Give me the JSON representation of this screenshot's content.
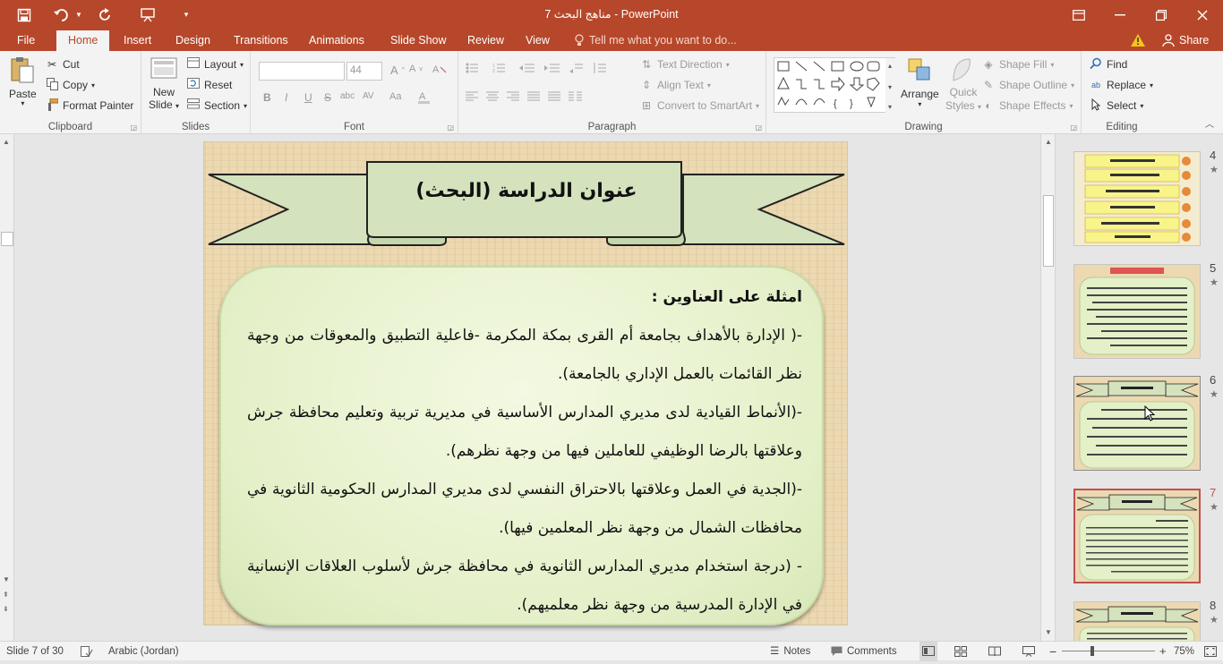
{
  "titlebar": {
    "title": "مناهج البحث 7 - PowerPoint",
    "quick_access": [
      "save-icon",
      "undo-icon",
      "redo-icon",
      "present-icon",
      "customize-icon"
    ]
  },
  "tabs": {
    "file": "File",
    "items": [
      "Home",
      "Insert",
      "Design",
      "Transitions",
      "Animations",
      "Slide Show",
      "Review",
      "View"
    ],
    "tell_me": "Tell me what you want to do...",
    "share": "Share"
  },
  "ribbon": {
    "clipboard": {
      "label": "Clipboard",
      "paste": "Paste",
      "cut": "Cut",
      "copy": "Copy",
      "format_painter": "Format Painter"
    },
    "slides": {
      "label": "Slides",
      "new_slide_line1": "New",
      "new_slide_line2": "Slide",
      "layout": "Layout",
      "reset": "Reset",
      "section": "Section"
    },
    "font": {
      "label": "Font",
      "size": "44",
      "bold": "B",
      "italic": "I",
      "underline": "U",
      "strike": "S",
      "shadow": "abc",
      "spacing": "AV",
      "case": "Aa"
    },
    "paragraph": {
      "label": "Paragraph",
      "text_direction": "Text Direction",
      "align_text": "Align Text",
      "smartart": "Convert to SmartArt"
    },
    "drawing": {
      "label": "Drawing",
      "arrange": "Arrange",
      "quick_styles_line1": "Quick",
      "quick_styles_line2": "Styles",
      "shape_fill": "Shape Fill",
      "shape_outline": "Shape Outline",
      "shape_effects": "Shape Effects"
    },
    "editing": {
      "label": "Editing",
      "find": "Find",
      "replace": "Replace",
      "select": "Select"
    }
  },
  "slide": {
    "title": "عنوان الدراسة (البحث)",
    "heading": "امثلة على العناوين :",
    "lines": [
      "-( الإدارة بالأهداف بجامعة أم القرى بمكة المكرمة -فاعلية التطبيق والمعوقات من وجهة نظر القائمات بالعمل الإداري بالجامعة).",
      "-(الأنماط القيادية لدى مديري المدارس الأساسية في مديرية تربية وتعليم محافظة جرش وعلاقتها بالرضا الوظيفي للعاملين فيها من وجهة نظرهم).",
      "-(الجدية في العمل وعلاقتها بالاحتراق النفسي لدى مديري المدارس الحكومية الثانوية في محافظات الشمال من وجهة نظر المعلمين فيها).",
      "- (درجة استخدام مديري المدارس الثانوية في محافظة جرش لأسلوب العلاقات الإنسانية في الإدارة المدرسية من وجهة نظر معلميهم)."
    ]
  },
  "thumbnails": [
    {
      "num": "4"
    },
    {
      "num": "5"
    },
    {
      "num": "6"
    },
    {
      "num": "7"
    },
    {
      "num": "8"
    }
  ],
  "statusbar": {
    "slide_info": "Slide 7 of 30",
    "language": "Arabic (Jordan)",
    "notes": "Notes",
    "comments": "Comments",
    "zoom": "75%"
  },
  "colors": {
    "accent": "#b7472a",
    "panel": "#e4f0c8",
    "banner": "#d4e2bd"
  }
}
